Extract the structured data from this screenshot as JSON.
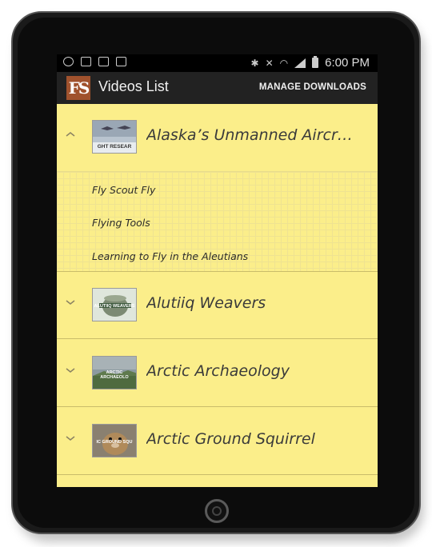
{
  "status_bar": {
    "time": "6:00 PM",
    "left_icons": [
      "alarm-icon",
      "image-icon",
      "mail-icon",
      "briefcase-icon"
    ],
    "right_icons": [
      "bluetooth-icon",
      "mute-icon",
      "wifi-icon",
      "signal-icon",
      "battery-icon"
    ]
  },
  "app_bar": {
    "logo_text": "FS",
    "title": "Videos List",
    "manage_downloads": "MANAGE DOWNLOADS"
  },
  "videos": [
    {
      "title": "Alaska’s Unmanned Aircr…",
      "thumb_text": "GHT RESEAR",
      "expanded": true,
      "children": [
        "Fly Scout Fly",
        "Flying Tools",
        "Learning to Fly in the Aleutians"
      ]
    },
    {
      "title": "Alutiiq Weavers",
      "thumb_text": "ALUTIIQ WEAVERS",
      "expanded": false
    },
    {
      "title": "Arctic Archaeology",
      "thumb_text": "ARCTIC ARCHAEOLO",
      "expanded": false
    },
    {
      "title": "Arctic Ground Squirrel",
      "thumb_text": "IC GROUND SQU",
      "expanded": false
    }
  ],
  "colors": {
    "list_background": "#fbee8a",
    "app_bar": "#222222",
    "logo": "#a0522d"
  }
}
